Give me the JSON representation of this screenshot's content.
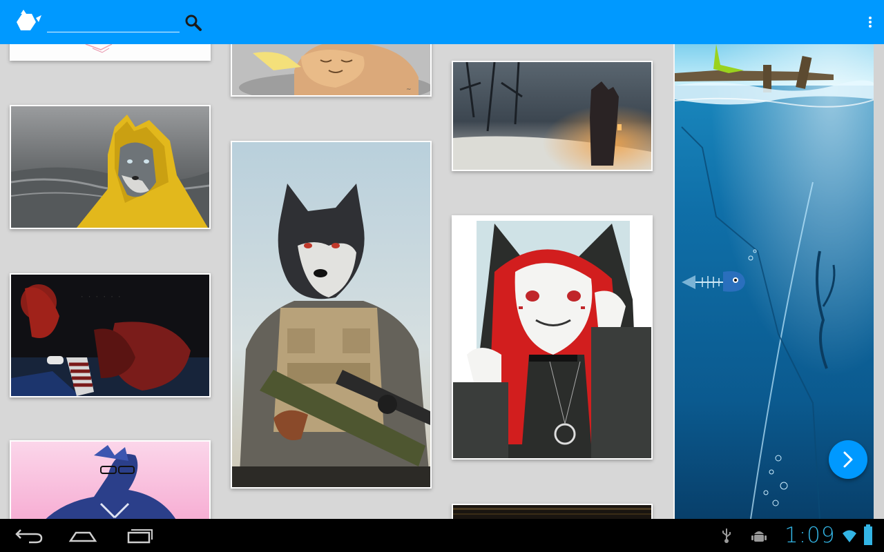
{
  "app_bar": {
    "background": "#0099ff",
    "logo_icon": "teapot-logo-icon",
    "search": {
      "placeholder": "",
      "value": "",
      "icon": "search-icon"
    },
    "overflow_icon": "overflow-menu-icon"
  },
  "gallery": {
    "columns": [
      {
        "items": [
          {
            "subject": "pink-illustration-partial"
          },
          {
            "subject": "wolf-in-yellow-raincoat-by-sea"
          },
          {
            "subject": "dark-red-character-with-game-controller"
          },
          {
            "subject": "blue-bird-character-with-glasses"
          }
        ]
      },
      {
        "items": [
          {
            "subject": "sleeping-tan-cat-sketch"
          },
          {
            "subject": "husky-soldier-with-sniper-rifle"
          }
        ]
      },
      {
        "items": [
          {
            "subject": "wolf-in-coat-with-lantern-in-snowy-forest"
          },
          {
            "subject": "red-haired-cat-girl-in-hood"
          },
          {
            "subject": "dark-painting-partial"
          }
        ]
      }
    ]
  },
  "detail": {
    "subject": "underwater-fish-skeleton-wallpaper",
    "next_button_icon": "chevron-right-icon",
    "accent": "#0099ff"
  },
  "system_bar": {
    "clock": "1:09",
    "clock_color": "#33b5e5",
    "icons": [
      "back-icon",
      "home-icon",
      "recent-apps-icon",
      "usb-icon",
      "android-debug-icon",
      "wifi-icon",
      "battery-icon"
    ]
  }
}
